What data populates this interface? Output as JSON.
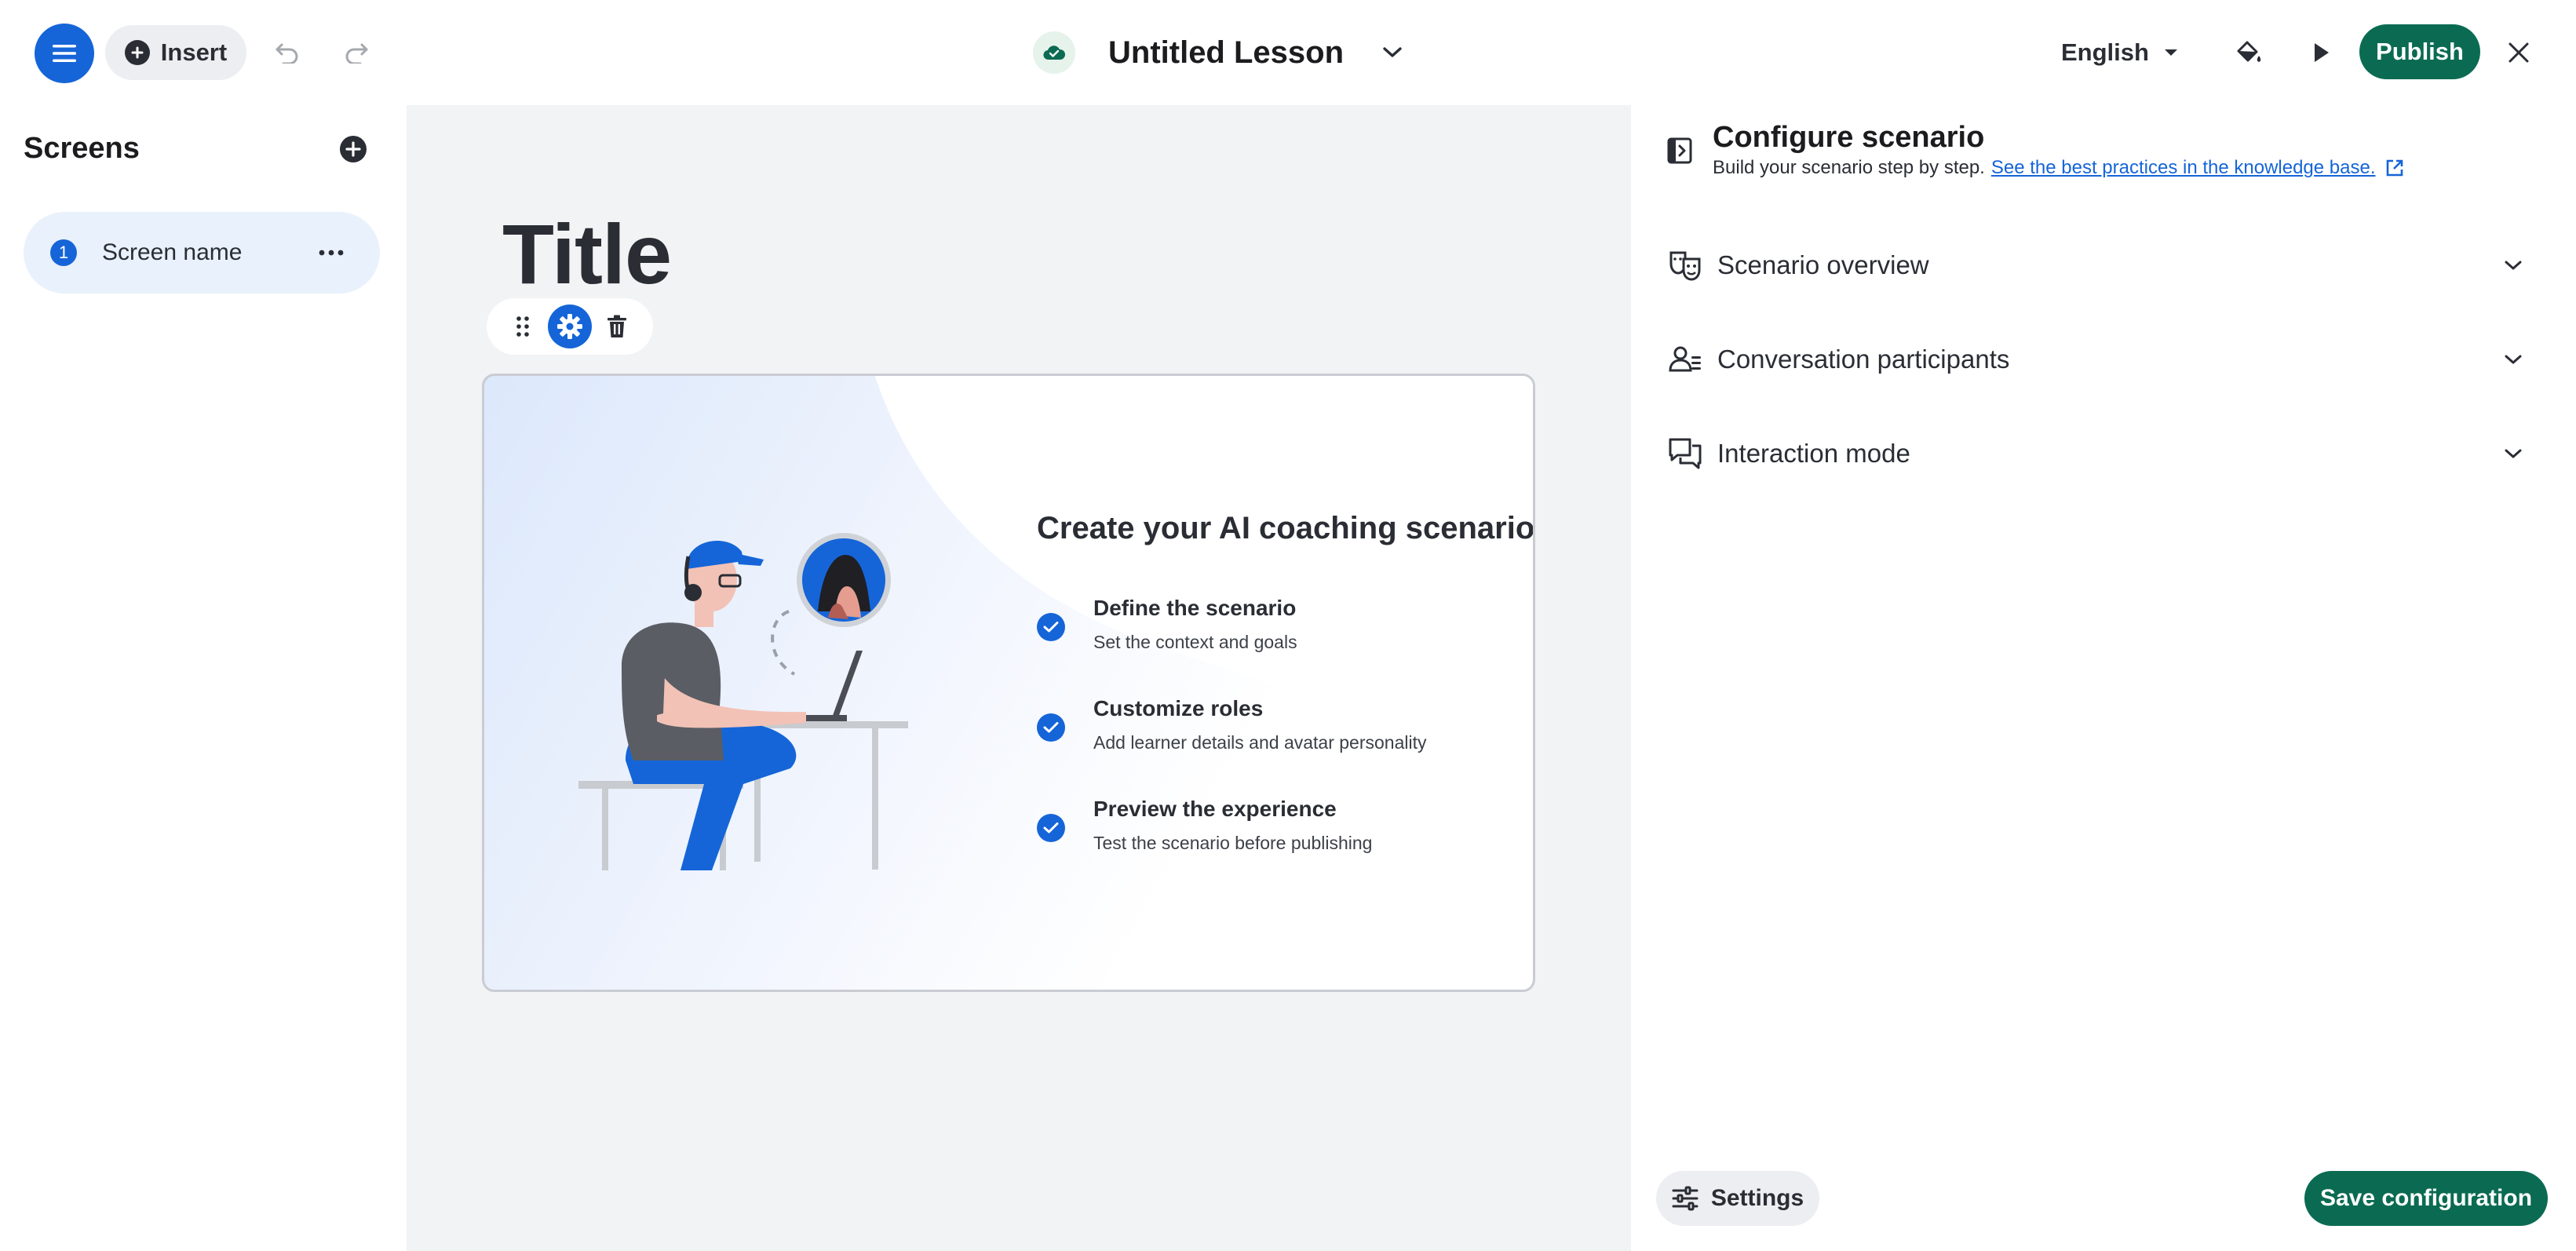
{
  "header": {
    "insert_label": "Insert",
    "lesson_title": "Untitled Lesson",
    "language": "English",
    "publish_label": "Publish"
  },
  "sidebar": {
    "title": "Screens",
    "screens": [
      {
        "number": "1",
        "name": "Screen name"
      }
    ]
  },
  "canvas": {
    "slide_title": "Title",
    "card": {
      "heading": "Create your AI coaching scenario",
      "steps": [
        {
          "title": "Define the scenario",
          "description": "Set the context and goals"
        },
        {
          "title": "Customize roles",
          "description": "Add learner details and avatar personality"
        },
        {
          "title": "Preview the experience",
          "description": "Test the scenario before publishing"
        }
      ]
    }
  },
  "panel": {
    "title": "Configure scenario",
    "subtitle": "Build your scenario step by step.",
    "link_text": "See the best practices in the knowledge base.",
    "sections": [
      {
        "label": "Scenario overview",
        "icon": "theater-masks-icon"
      },
      {
        "label": "Conversation participants",
        "icon": "participants-icon"
      },
      {
        "label": "Interaction mode",
        "icon": "chat-bubbles-icon"
      }
    ],
    "settings_label": "Settings",
    "save_label": "Save configuration"
  },
  "colors": {
    "primary_blue": "#1565d8",
    "brand_green": "#0b6b52",
    "canvas_bg": "#f2f3f5",
    "selected_bg": "#e9f1fc"
  }
}
